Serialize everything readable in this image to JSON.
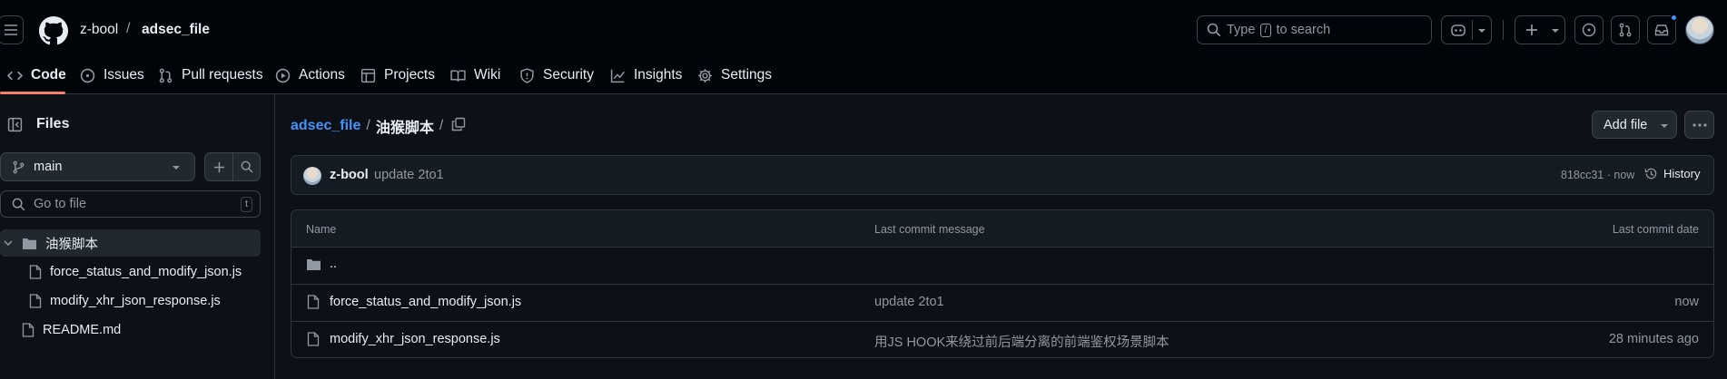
{
  "header": {
    "owner": "z-bool",
    "separator": "/",
    "repo": "adsec_file",
    "search_prefix": "Type",
    "search_key": "/",
    "search_suffix": "to search"
  },
  "tabs": [
    {
      "label": "Code"
    },
    {
      "label": "Issues"
    },
    {
      "label": "Pull requests"
    },
    {
      "label": "Actions"
    },
    {
      "label": "Projects"
    },
    {
      "label": "Wiki"
    },
    {
      "label": "Security"
    },
    {
      "label": "Insights"
    },
    {
      "label": "Settings"
    }
  ],
  "sidebar": {
    "title": "Files",
    "branch": "main",
    "goto_placeholder": "Go to file",
    "goto_shortcut": "t",
    "tree": [
      {
        "label": "油猴脚本",
        "type": "folder"
      },
      {
        "label": "force_status_and_modify_json.js",
        "type": "file"
      },
      {
        "label": "modify_xhr_json_response.js",
        "type": "file"
      },
      {
        "label": "README.md",
        "type": "file"
      }
    ]
  },
  "breadcrumb": {
    "repo": "adsec_file",
    "sep": "/",
    "folder": "油猴脚本",
    "trail": "/"
  },
  "add_file_label": "Add file",
  "commit": {
    "author": "z-bool",
    "message": "update 2to1",
    "meta": "818cc31 · now",
    "history_label": "History"
  },
  "table": {
    "headers": {
      "name": "Name",
      "message": "Last commit message",
      "date": "Last commit date"
    },
    "parent_label": "..",
    "rows": [
      {
        "name": "force_status_and_modify_json.js",
        "message": "update 2to1",
        "date": "now"
      },
      {
        "name": "modify_xhr_json_response.js",
        "message": "用JS HOOK来绕过前后端分离的前端鉴权场景脚本",
        "date": "28 minutes ago"
      }
    ]
  },
  "colors": {
    "accent_link": "#4493f8",
    "underline": "#f78166",
    "notification_dot": "#4493f8"
  }
}
